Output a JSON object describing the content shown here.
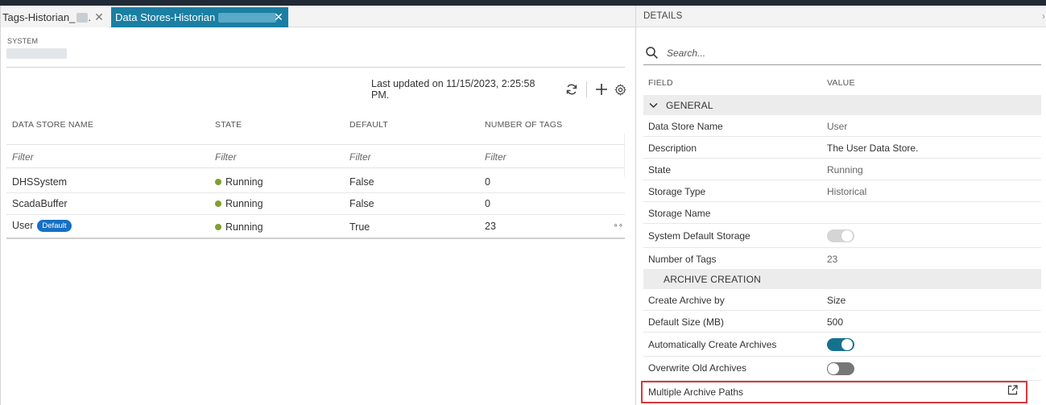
{
  "tabs": [
    {
      "label": "Tags-Historian_",
      "suffix": "."
    },
    {
      "label": "Data Stores-Historian"
    }
  ],
  "system": {
    "label": "SYSTEM"
  },
  "toolbar": {
    "last_updated": "Last updated on 11/15/2023, 2:25:58 PM."
  },
  "table": {
    "columns": [
      "DATA STORE NAME",
      "STATE",
      "DEFAULT",
      "NUMBER OF TAGS"
    ],
    "filter_placeholder": "Filter",
    "rows": [
      {
        "name": "DHSSystem",
        "state": "Running",
        "default": "False",
        "tags": "0",
        "badge": ""
      },
      {
        "name": "ScadaBuffer",
        "state": "Running",
        "default": "False",
        "tags": "0",
        "badge": ""
      },
      {
        "name": "User",
        "state": "Running",
        "default": "True",
        "tags": "23",
        "badge": "Default"
      }
    ],
    "state_color": "#7ea02c",
    "row_more_label": "∘∘"
  },
  "details": {
    "title": "DETAILS",
    "collapse_label": "›",
    "search_placeholder": "Search...",
    "field_header": "FIELD",
    "value_header": "VALUE",
    "general_section": "GENERAL",
    "general_rows": [
      {
        "field": "Data Store Name",
        "value": "User"
      },
      {
        "field": "Description",
        "value": "The User Data Store."
      },
      {
        "field": "State",
        "value": "Running"
      },
      {
        "field": "Storage Type",
        "value": "Historical"
      },
      {
        "field": "Storage Name",
        "value": ""
      },
      {
        "field": "System Default Storage",
        "value": ""
      },
      {
        "field": "Number of Tags",
        "value": "23"
      }
    ],
    "system_default_storage": "on (disabled)",
    "archive_section": "ARCHIVE CREATION",
    "archive_rows": [
      {
        "field": "Create Archive by",
        "value": "Size"
      },
      {
        "field": "Default Size (MB)",
        "value": "500"
      },
      {
        "field": "Automatically Create Archives",
        "value": ""
      },
      {
        "field": "Overwrite Old Archives",
        "value": ""
      },
      {
        "field": "Multiple Archive Paths",
        "value": ""
      }
    ],
    "auto_create_archives": "on",
    "overwrite_old_archives": "off"
  },
  "colors": {
    "tab_active": "#1a7fa3",
    "badge": "#1570c4",
    "toggle_on": "#16718f",
    "highlight": "#d9383a"
  }
}
